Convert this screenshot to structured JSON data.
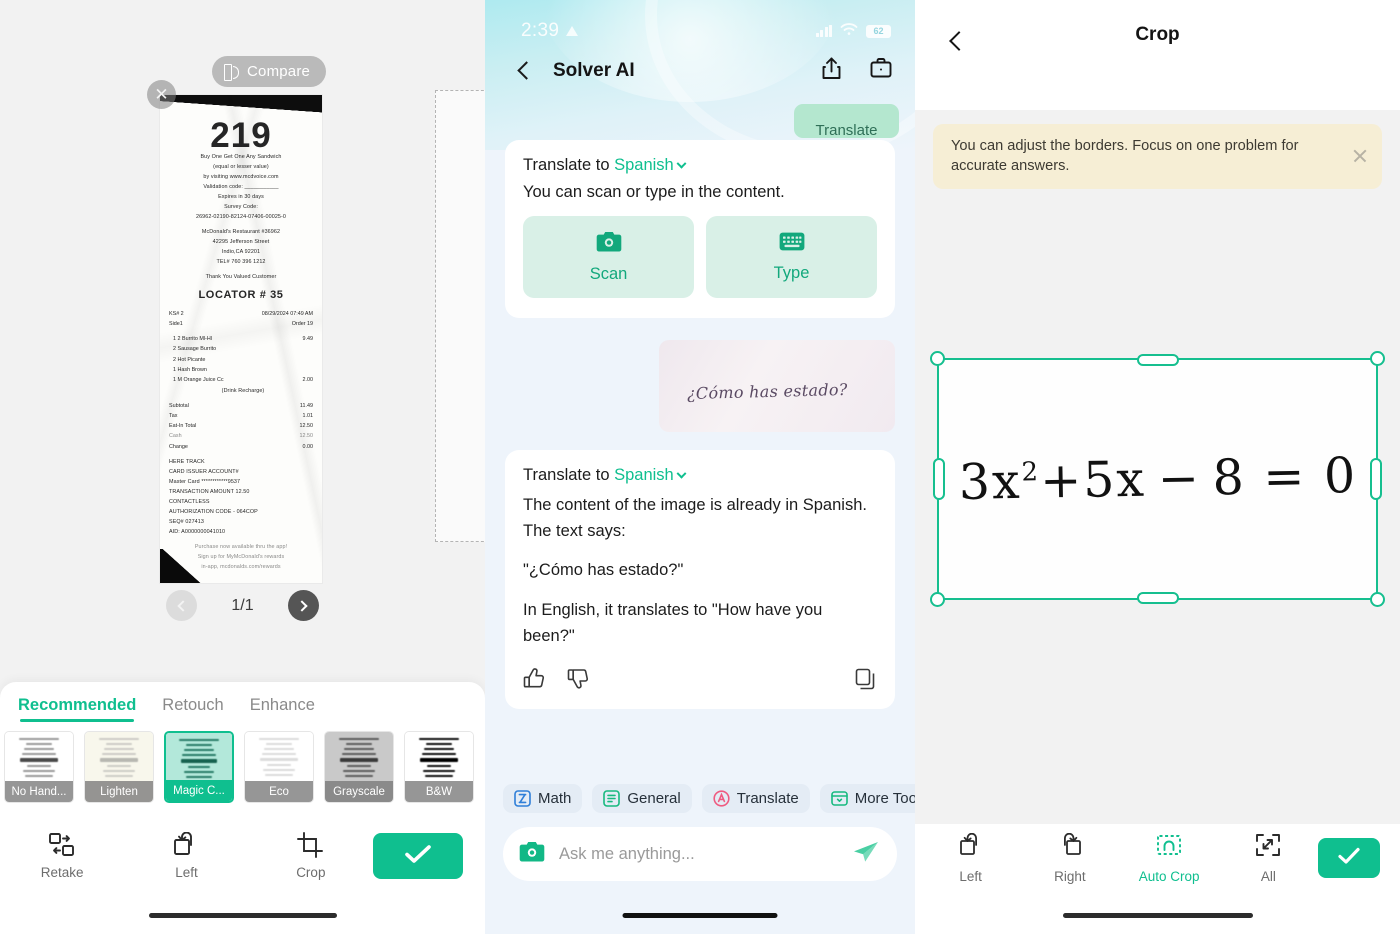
{
  "panel1": {
    "compare_label": "Compare",
    "close_icon": "close-icon",
    "page_indicator": "1/1",
    "receipt": {
      "number": "219",
      "promo_line1": "Buy One Get One Any Sandwich",
      "promo_line2": "(equal or lesser value)",
      "promo_line3": "by visiting www.mcdvoice.com",
      "validation": "Validation code: ___________",
      "expires": "Expires in 30 days",
      "survey_label": "Survey Code:",
      "survey_code": "26962-02190-82124-07406-00025-0",
      "store": "McDonald's Restaurant #36962",
      "address": "42295 Jefferson Street",
      "city": "Indio,CA 92201",
      "phone": "TEL# 760 396 1212",
      "thanks": "Thank You Valued Customer",
      "locator": "LOCATOR # 35",
      "ksn": "KS# 2",
      "datetime": "08/29/2024 07:49 AM",
      "side": "Side1",
      "order": "Order 19",
      "items": [
        {
          "name": "1 2 Burrito Ml-Hl",
          "price": "9.49"
        },
        {
          "name": "2 Sausage Burrito",
          "price": ""
        },
        {
          "name": "2 Hot Picante",
          "price": ""
        },
        {
          "name": "1 Hash Brown",
          "price": ""
        },
        {
          "name": "1 M Orange Juice Cc",
          "price": "2.00"
        },
        {
          "name": "(Drink Recharge)",
          "price": ""
        }
      ],
      "totals": [
        {
          "label": "Subtotal",
          "value": "11.49"
        },
        {
          "label": "Tax",
          "value": "1.01"
        },
        {
          "label": "Eat-In Total",
          "value": "12.50"
        },
        {
          "label": "Cash",
          "value": "12.50"
        },
        {
          "label": "Change",
          "value": "0.00"
        }
      ],
      "pay_lines": [
        "HERE TRACK",
        "CARD ISSUER              ACCOUNT#",
        "Master Card      ************9537",
        "TRANSACTION AMOUNT          12.50",
        "CONTACTLESS",
        "AUTHORIZATION CODE - 064COP",
        "SEQ# 027413",
        "AID: A0000000041010"
      ],
      "footer1": "Purchase now available thru the app!",
      "footer2": "Sign up for MyMcDonald's rewards",
      "footer3": "in-app, mcdonalds.com/rewards"
    },
    "tabs": [
      {
        "label": "Recommended",
        "active": true
      },
      {
        "label": "Retouch",
        "active": false
      },
      {
        "label": "Enhance",
        "active": false
      }
    ],
    "filters": [
      {
        "label": "No Hand...",
        "selected": false
      },
      {
        "label": "Lighten",
        "selected": false
      },
      {
        "label": "Magic C...",
        "selected": true
      },
      {
        "label": "Eco",
        "selected": false
      },
      {
        "label": "Grayscale",
        "selected": false
      },
      {
        "label": "B&W",
        "selected": false
      }
    ],
    "tools": [
      {
        "label": "Retake",
        "icon": "retake-icon"
      },
      {
        "label": "Left",
        "icon": "rotate-left-icon"
      },
      {
        "label": "Crop",
        "icon": "crop-icon"
      }
    ],
    "done_icon": "check-icon"
  },
  "panel2": {
    "status": {
      "time": "2:39",
      "battery": "62"
    },
    "nav": {
      "title": "Solver AI",
      "back_icon": "chevron-left-icon",
      "share_icon": "share-icon",
      "briefcase_icon": "briefcase-icon"
    },
    "cut_chip": "Translate",
    "prompt_card": {
      "prefix": "Translate to",
      "language": "Spanish",
      "hint": "You can scan or type in the content.",
      "actions": [
        {
          "label": "Scan",
          "icon": "camera-icon"
        },
        {
          "label": "Type",
          "icon": "keyboard-icon"
        }
      ]
    },
    "user_image_text": "¿Cómo has estado?",
    "answer_card": {
      "prefix": "Translate to",
      "language": "Spanish",
      "p1": "The content of the image is already in Spanish. The text says:",
      "p2": "\"¿Cómo has estado?\"",
      "p3": "In English, it translates to \"How have you been?\"",
      "thumbs_up_icon": "thumb-up-icon",
      "thumbs_down_icon": "thumb-down-icon",
      "copy_icon": "copy-icon"
    },
    "tool_chips": [
      {
        "label": "Math",
        "icon": "math-icon",
        "color": "#2f7fd8"
      },
      {
        "label": "General",
        "icon": "general-icon",
        "color": "#17b97f"
      },
      {
        "label": "Translate",
        "icon": "translate-icon",
        "color": "#ef5b81"
      },
      {
        "label": "More Tools",
        "icon": "more-tools-icon",
        "color": "#17b97f"
      }
    ],
    "composer": {
      "placeholder": "Ask me anything...",
      "camera_icon": "camera-icon",
      "send_icon": "send-icon"
    }
  },
  "panel3": {
    "nav": {
      "title": "Crop",
      "back_icon": "chevron-left-icon"
    },
    "banner": {
      "text": "You can adjust the borders. Focus on one problem for accurate answers.",
      "close_icon": "close-icon"
    },
    "equation": {
      "base": "3x",
      "exp": "2",
      "rest": "+5x − 8 = 0"
    },
    "tools": [
      {
        "label": "Left",
        "icon": "rotate-left-icon",
        "active": false
      },
      {
        "label": "Right",
        "icon": "rotate-right-icon",
        "active": false
      },
      {
        "label": "Auto Crop",
        "icon": "auto-crop-icon",
        "active": true
      },
      {
        "label": "All",
        "icon": "select-all-icon",
        "active": false
      }
    ],
    "done_icon": "check-icon"
  },
  "colors": {
    "accent": "#0fbf8f",
    "crop_frame": "#16bf8f",
    "banner_bg": "#f6eed5"
  }
}
